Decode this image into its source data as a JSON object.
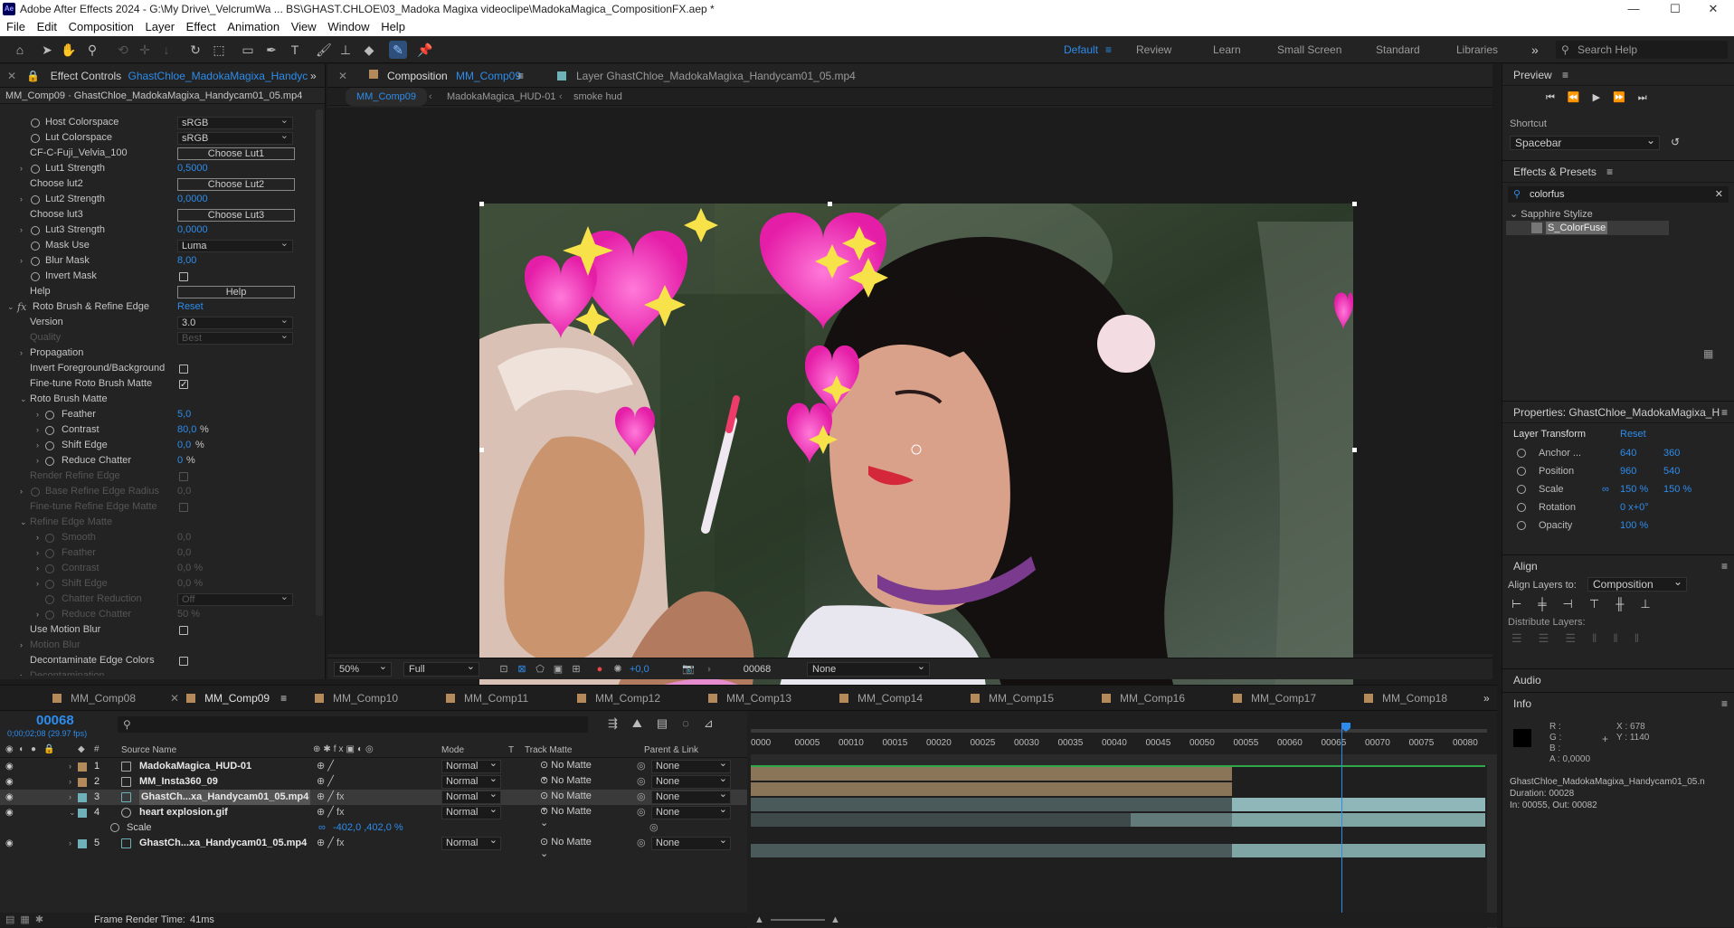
{
  "titlebar": {
    "app_icon": "Ae",
    "title": "Adobe After Effects 2024 - G:\\My Drive\\_VelcrumWa ... BS\\GHAST.CHLOE\\03_Madoka Magixa videoclipe\\MadokaMagica_CompositionFX.aep *",
    "minimize": "—",
    "maximize": "☐",
    "close": "✕"
  },
  "menu": [
    "File",
    "Edit",
    "Composition",
    "Layer",
    "Effect",
    "Animation",
    "View",
    "Window",
    "Help"
  ],
  "workspaces": {
    "default": "Default",
    "items": [
      "Review",
      "Learn",
      "Small Screen",
      "Standard",
      "Libraries"
    ],
    "overflow": "»",
    "search_placeholder": "Search Help"
  },
  "effect_controls": {
    "tab_title": "Effect Controls",
    "tab_layer": "GhastChloe_MadokaMagixa_Handyc",
    "subheader": "MM_Comp09 · GhastChloe_MadokaMagixa_Handycam01_05.mp4",
    "rows": {
      "host_colorspace": {
        "label": "Host Colorspace",
        "value": "sRGB"
      },
      "lut_colorspace": {
        "label": "Lut Colorspace",
        "value": "sRGB"
      },
      "lut1_name": {
        "label": "CF-C-Fuji_Velvia_100",
        "button": "Choose Lut1"
      },
      "lut1_strength": {
        "label": "Lut1 Strength",
        "value": "0,5000"
      },
      "choose_lut2": {
        "label": "Choose lut2",
        "button": "Choose Lut2"
      },
      "lut2_strength": {
        "label": "Lut2 Strength",
        "value": "0,0000"
      },
      "choose_lut3": {
        "label": "Choose lut3",
        "button": "Choose Lut3"
      },
      "lut3_strength": {
        "label": "Lut3 Strength",
        "value": "0,0000"
      },
      "mask_use": {
        "label": "Mask Use",
        "value": "Luma"
      },
      "blur_mask": {
        "label": "Blur Mask",
        "value": "8,00"
      },
      "invert_mask": {
        "label": "Invert Mask"
      },
      "help": {
        "label": "Help",
        "button": "Help"
      },
      "roto": {
        "label": "Roto Brush & Refine Edge",
        "reset": "Reset"
      },
      "version": {
        "label": "Version",
        "value": "3.0"
      },
      "quality": {
        "label": "Quality",
        "value": "Best"
      },
      "propagation": {
        "label": "Propagation"
      },
      "invert_fg": {
        "label": "Invert Foreground/Background"
      },
      "fine_tune": {
        "label": "Fine-tune Roto Brush Matte"
      },
      "roto_matte": {
        "label": "Roto Brush Matte"
      },
      "feather": {
        "label": "Feather",
        "value": "5,0"
      },
      "contrast": {
        "label": "Contrast",
        "value": "80,0",
        "unit": "%"
      },
      "shift_edge": {
        "label": "Shift Edge",
        "value": "0,0",
        "unit": "%"
      },
      "reduce_chatter": {
        "label": "Reduce Chatter",
        "value": "0",
        "unit": "%"
      },
      "render_refine": {
        "label": "Render Refine Edge"
      },
      "base_radius": {
        "label": "Base Refine Edge Radius",
        "value": "0,0"
      },
      "fine_tune_refine": {
        "label": "Fine-tune Refine Edge Matte"
      },
      "refine_matte": {
        "label": "Refine Edge Matte"
      },
      "smooth": {
        "label": "Smooth",
        "value": "0,0"
      },
      "feather2": {
        "label": "Feather",
        "value": "0,0"
      },
      "contrast2": {
        "label": "Contrast",
        "value": "0,0 %"
      },
      "shift_edge2": {
        "label": "Shift Edge",
        "value": "0,0 %"
      },
      "chatter_reduction": {
        "label": "Chatter Reduction",
        "value": "Off"
      },
      "reduce_chatter2": {
        "label": "Reduce Chatter",
        "value": "50 %"
      },
      "use_motion_blur": {
        "label": "Use Motion Blur"
      },
      "motion_blur": {
        "label": "Motion Blur"
      },
      "decontaminate": {
        "label": "Decontaminate Edge Colors"
      },
      "decontamination": {
        "label": "Decontamination"
      }
    }
  },
  "composition": {
    "tab_label": "Composition",
    "tab_comp": "MM_Comp09",
    "layer_tab": "Layer  GhastChloe_MadokaMagixa_Handycam01_05.mp4",
    "crumbs": [
      "MM_Comp09",
      "MadokaMagica_HUD-01",
      "smoke hud"
    ],
    "zoom": "50%",
    "resolution": "Full",
    "exposure": "+0,0",
    "frame": "00068",
    "view": "None"
  },
  "preview": {
    "title": "Preview",
    "shortcut_label": "Shortcut",
    "shortcut": "Spacebar"
  },
  "effects_presets": {
    "title": "Effects & Presets",
    "search": "colorfus",
    "category": "Sapphire Stylize",
    "item": "S_ColorFuse"
  },
  "properties": {
    "title": "Properties: GhastChloe_MadokaMagixa_H",
    "section": "Layer Transform",
    "reset": "Reset",
    "rows": [
      {
        "label": "Anchor ...",
        "v1": "640",
        "v2": "360"
      },
      {
        "label": "Position",
        "v1": "960",
        "v2": "540"
      },
      {
        "label": "Scale",
        "v1": "150 %",
        "v2": "150 %"
      },
      {
        "label": "Rotation",
        "v1": "0 x+0°",
        "v2": ""
      },
      {
        "label": "Opacity",
        "v1": "100 %",
        "v2": ""
      }
    ]
  },
  "align": {
    "title": "Align",
    "align_to_label": "Align Layers to:",
    "align_to": "Composition",
    "distribute": "Distribute Layers:"
  },
  "audio": {
    "title": "Audio"
  },
  "info": {
    "title": "Info",
    "r": "R :",
    "g": "G :",
    "b": "B :",
    "a": "A : 0,0000",
    "x": "X : 678",
    "y": "Y : 1140",
    "layer": "GhastChloe_MadokaMagixa_Handycam01_05.n",
    "duration": "Duration: 00028",
    "inout": "In: 00055, Out: 00082"
  },
  "timeline": {
    "tabs": [
      "MM_Comp08",
      "MM_Comp09",
      "MM_Comp10",
      "MM_Comp11",
      "MM_Comp12",
      "MM_Comp13",
      "MM_Comp14",
      "MM_Comp15",
      "MM_Comp16",
      "MM_Comp17",
      "MM_Comp18"
    ],
    "current_frame": "00068",
    "fps": "0;00;02;08 (29.97 fps)",
    "headers": {
      "source": "Source Name",
      "mode": "Mode",
      "t": "T",
      "matte": "Track Matte",
      "parent": "Parent & Link"
    },
    "layers": [
      {
        "num": "1",
        "name": "MadokaMagica_HUD-01",
        "mode": "Normal",
        "matte": "No Matte",
        "parent": "None"
      },
      {
        "num": "2",
        "name": "MM_Insta360_09",
        "mode": "Normal",
        "matte": "No Matte",
        "parent": "None"
      },
      {
        "num": "3",
        "name": "GhastCh...xa_Handycam01_05.mp4",
        "mode": "Normal",
        "matte": "No Matte",
        "parent": "None"
      },
      {
        "num": "4",
        "name": "heart explosion.gif",
        "mode": "Normal",
        "matte": "No Matte",
        "parent": "None"
      },
      {
        "num": "5",
        "name": "GhastCh...xa_Handycam01_05.mp4",
        "mode": "Normal",
        "matte": "No Matte",
        "parent": "None"
      }
    ],
    "scale_label": "Scale",
    "scale_value": "-402,0 ,402,0 %",
    "ruler": [
      "0000",
      "00005",
      "00010",
      "00015",
      "00020",
      "00025",
      "00030",
      "00035",
      "00040",
      "00045",
      "00050",
      "00055",
      "00060",
      "00065",
      "00070",
      "00075",
      "00080"
    ],
    "render_time_label": "Frame Render Time:",
    "render_time": "41ms"
  }
}
